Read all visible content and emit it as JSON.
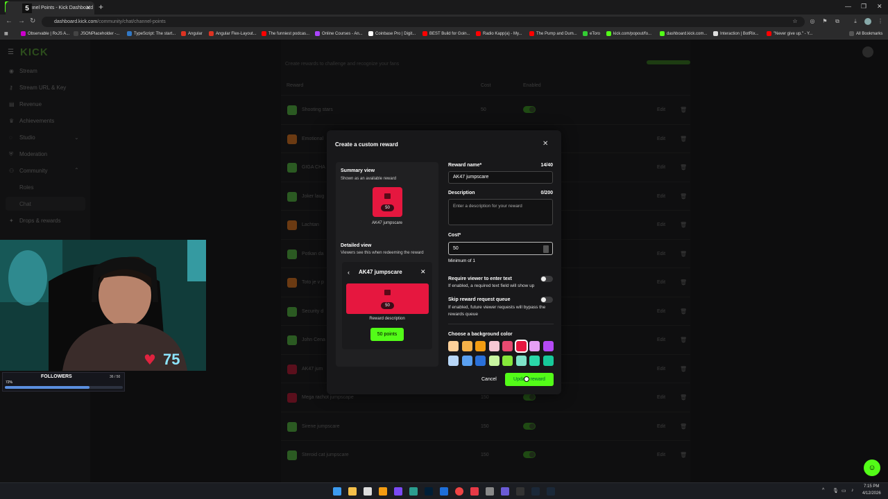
{
  "browser": {
    "tab_title": "hannel Points - Kick Dashboard",
    "url_host": "dashboard.kick.com",
    "url_path": "/community/chat/channel-points",
    "bookmarks": [
      "Observable | RxJS A...",
      "JSONPlaceholder -...",
      "TypeScript: The start...",
      "Angular",
      "Angular Flex-Layout...",
      "The funniest podcas...",
      "Online Courses - An...",
      "Coinbase Pro | Digit...",
      "BEST Build for Goin...",
      "Radio Kapp(a) - My...",
      "The Pump and Dum...",
      "eToro",
      "kick.com/popout/fo...",
      "dashboard.kick.com...",
      "Interaction | BotRix...",
      "\"Never give up.\" - Y..."
    ],
    "all_bookmarks": "All Bookmarks"
  },
  "sidebar": {
    "logo": "KICK",
    "items": [
      "Stream",
      "Stream URL & Key",
      "Revenue",
      "Achievements",
      "Studio",
      "Moderation",
      "Community",
      "Drops & rewards"
    ],
    "community_sub": [
      "Roles",
      "Chat"
    ]
  },
  "table": {
    "subtitle": "Create rewards to challenge and recognize your fans",
    "headers": {
      "reward": "Reward",
      "cost": "Cost",
      "enabled": "Enabled"
    },
    "edit_label": "Edit",
    "rows": [
      {
        "name": "Shooting stars",
        "cost": "50",
        "color": "#2b5a22"
      },
      {
        "name": "Emotional",
        "cost": "",
        "color": "#6b3a12"
      },
      {
        "name": "GIGA CHA",
        "cost": "",
        "color": "#2b5a22"
      },
      {
        "name": "Joker laug",
        "cost": "",
        "color": "#2b5a22"
      },
      {
        "name": "Lachtan",
        "cost": "",
        "color": "#6b3a12"
      },
      {
        "name": "Potkan da",
        "cost": "",
        "color": "#2b5a22"
      },
      {
        "name": "Toto je v p",
        "cost": "",
        "color": "#6b3a12"
      },
      {
        "name": "Security d",
        "cost": "",
        "color": "#2b5a22"
      },
      {
        "name": "John Cena",
        "cost": "",
        "color": "#2b5a22"
      },
      {
        "name": "AK47 jum",
        "cost": "",
        "color": "#5a0f1c"
      },
      {
        "name": "Mega rachot jumpscape",
        "cost": "150",
        "color": "#5a0f1c"
      },
      {
        "name": "Sirene jumpscare",
        "cost": "150",
        "color": "#2b5a22"
      },
      {
        "name": "Steroid cat jumpscare",
        "cost": "150",
        "color": "#2b5a22"
      }
    ]
  },
  "modal": {
    "title": "Create a custom reward",
    "summary_label": "Summary view",
    "summary_hint": "Shown as an available reward",
    "card_cost": "50",
    "card_name": "AK47 jumpscare",
    "detailed_label": "Detailed view",
    "detailed_hint": "Viewers see this when redeeming the reward",
    "detail_title": "AK47 jumpscare",
    "detail_cost": "50",
    "detail_desc": "Reward description",
    "detail_points": "50 points",
    "reward_name_label": "Reward name*",
    "reward_name_count": "14/40",
    "reward_name_value": "AK47 jumpscare",
    "description_label": "Description",
    "description_count": "0/200",
    "description_placeholder": "Enter a description for your reward",
    "cost_label": "Cost*",
    "cost_value": "50",
    "cost_min": "Minimum of 1",
    "require_text_label": "Require viewer to enter text",
    "require_text_desc": "If enabled, a required text field will show up",
    "skip_queue_label": "Skip reward request queue",
    "skip_queue_desc": "If enabled, future viewer requests will bypass the rewards queue",
    "bg_color_label": "Choose a background color",
    "colors_row1": [
      "#fcd09a",
      "#f5b14a",
      "#f39c12",
      "#f8c8d4",
      "#e64a70",
      "#e6173f",
      "#e6a0f5",
      "#b44af5"
    ],
    "colors_row2": [
      "#b7d6f7",
      "#5aa0f0",
      "#2a70d8",
      "#c8f5a0",
      "#86e83a",
      "#7ee3c8",
      "#2ad7a8",
      "#17c99a"
    ],
    "selected_color": "#e6173f",
    "cancel": "Cancel",
    "update": "Update reward"
  },
  "overlay": {
    "hearts": "75",
    "followers_label": "FOLLOWERS",
    "followers_count": "36 / 50",
    "followers_percent": "72%",
    "followers_progress": 0.72
  },
  "taskbar": {
    "time": "7:15 PM",
    "date": "4/12/2026"
  }
}
